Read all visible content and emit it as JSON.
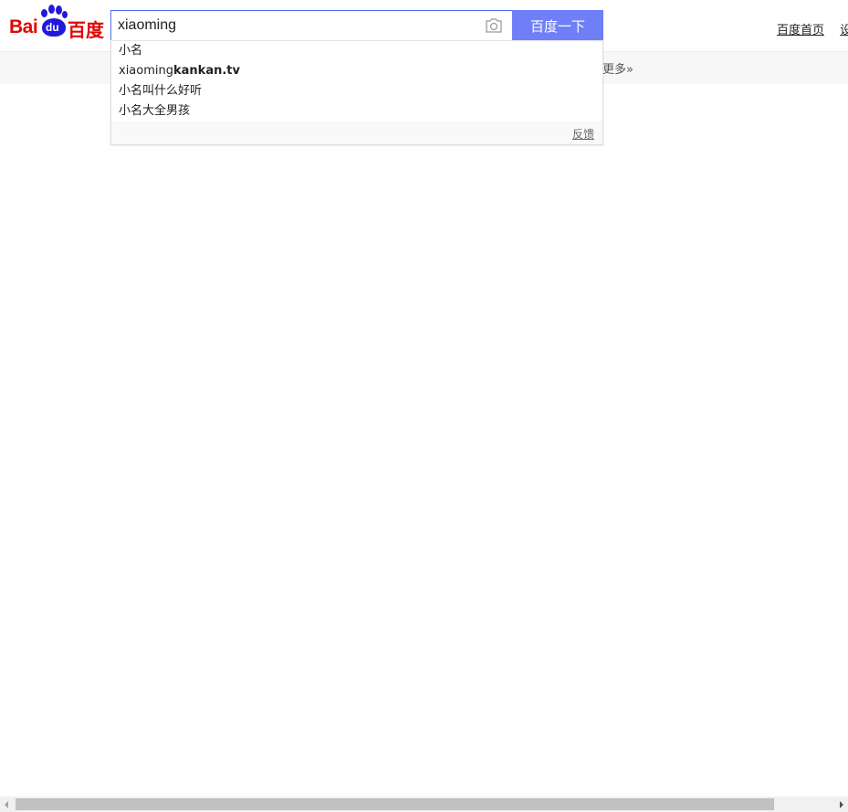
{
  "logo": {
    "latin": "Bai",
    "paw_text": "du",
    "chinese": "百度",
    "brand_red": "#e10601",
    "brand_blue": "#2319dc"
  },
  "search": {
    "query": "xiaoming",
    "button_label": "百度一下",
    "button_color": "#6e7ff7",
    "camera_icon": "camera-icon"
  },
  "top_links": [
    {
      "label": "百度首页"
    },
    {
      "label": "设置"
    }
  ],
  "subnav": {
    "more_label": "更多»"
  },
  "suggestions": {
    "items": [
      {
        "plain": "小名",
        "bold": ""
      },
      {
        "plain": "xiaoming",
        "bold": "kankan.tv"
      },
      {
        "plain": "小名叫什么好听",
        "bold": ""
      },
      {
        "plain": "小名大全男孩",
        "bold": ""
      }
    ],
    "feedback_label": "反馈"
  }
}
